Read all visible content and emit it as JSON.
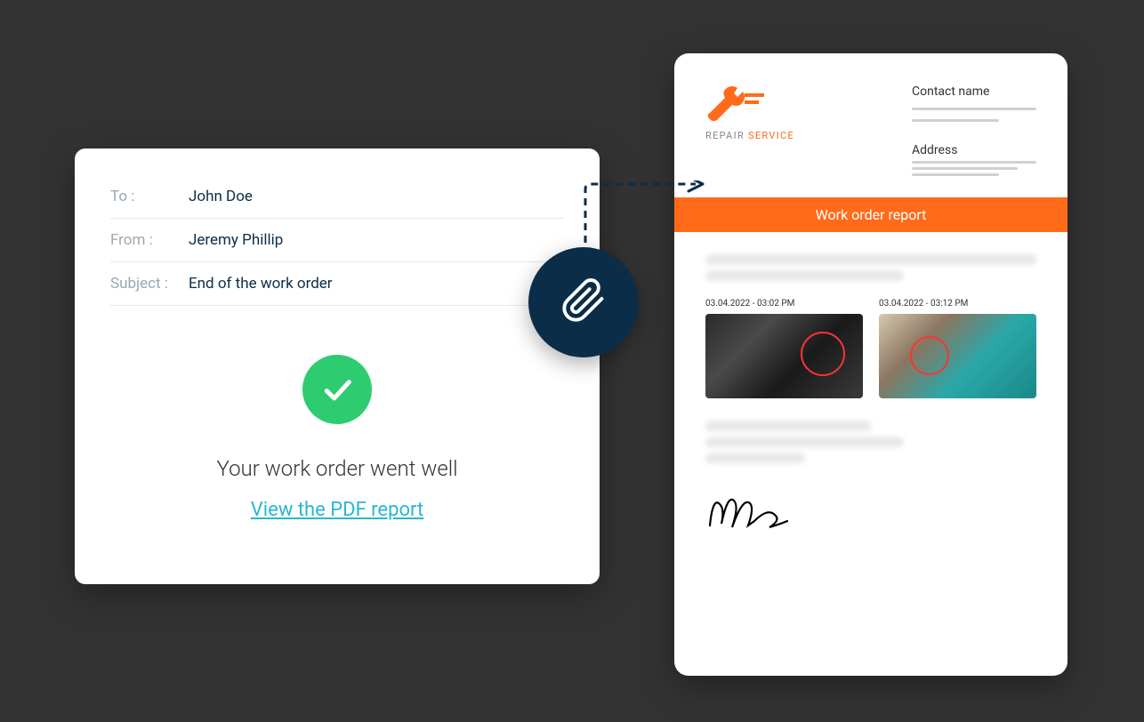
{
  "email": {
    "to_label": "To :",
    "to_value": "John Doe",
    "from_label": "From :",
    "from_value": "Jeremy Phillip",
    "subject_label": "Subject :",
    "subject_value": "End of the work order",
    "success_message": "Your work order went well",
    "pdf_link": "View the PDF report"
  },
  "report": {
    "logo_repair": "REPAIR",
    "logo_service": " SERVICE",
    "contact_label": "Contact name",
    "address_label": "Address",
    "banner_title": "Work order report",
    "photo1_timestamp": "03.04.2022 - 03:02 PM",
    "photo2_timestamp": "03.04.2022 - 03:12 PM"
  }
}
